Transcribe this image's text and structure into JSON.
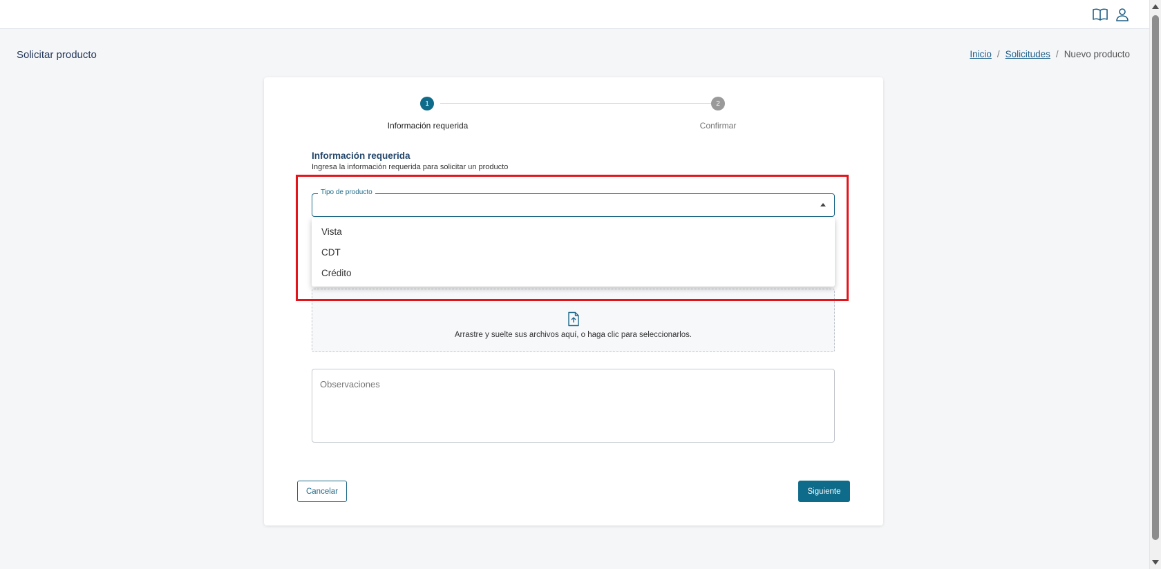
{
  "header": {
    "icons": [
      "book-icon",
      "user-icon"
    ]
  },
  "page": {
    "title": "Solicitar producto"
  },
  "breadcrumb": {
    "items": [
      {
        "label": "Inicio",
        "link": true
      },
      {
        "label": "Solicitudes",
        "link": true
      },
      {
        "label": "Nuevo producto",
        "link": false
      }
    ],
    "separator": "/"
  },
  "stepper": {
    "steps": [
      {
        "number": "1",
        "label": "Información requerida",
        "active": true
      },
      {
        "number": "2",
        "label": "Confirmar",
        "active": false
      }
    ]
  },
  "form": {
    "section_title": "Información requerida",
    "section_subtitle": "Ingresa la información requerida para solicitar un producto",
    "product_type": {
      "label": "Tipo de producto",
      "value": "",
      "options": [
        "Vista",
        "CDT",
        "Crédito"
      ]
    },
    "upload": {
      "text": "Arrastre y suelte sus archivos aquí, o haga clic para seleccionarlos."
    },
    "observations": {
      "placeholder": "Observaciones",
      "value": ""
    }
  },
  "actions": {
    "cancel_label": "Cancelar",
    "next_label": "Siguiente"
  },
  "colors": {
    "primary": "#0e6b8a",
    "highlight": "#e3151a",
    "title": "#24476b"
  }
}
